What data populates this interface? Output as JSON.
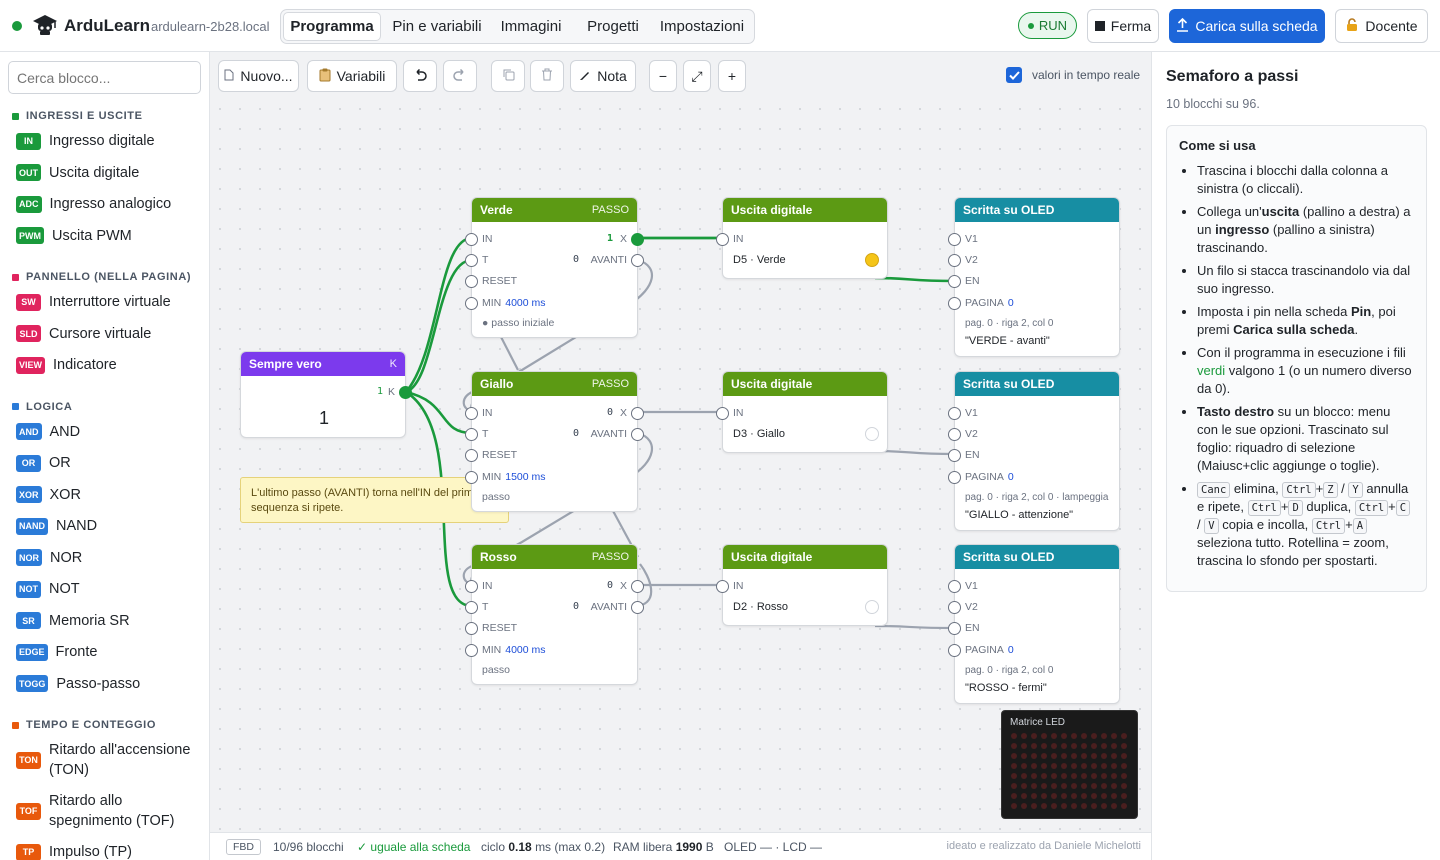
{
  "app": {
    "name": "ArduLearn",
    "host": "ardulearn-2b28.local"
  },
  "tabs": [
    {
      "label": "Programma",
      "active": true
    },
    {
      "label": "Pin e variabili"
    },
    {
      "label": "Immagini"
    },
    {
      "label": "Progetti"
    },
    {
      "label": "Impostazioni"
    }
  ],
  "header": {
    "run_label": "RUN",
    "stop_label": "Ferma",
    "upload_label": "Carica sulla scheda",
    "teacher_label": "Docente"
  },
  "palette": {
    "search_placeholder": "Cerca blocco...",
    "categories": [
      {
        "title": "INGRESSI E USCITE",
        "color": "#1a9a3c",
        "items": [
          {
            "badge": "IN",
            "label": "Ingresso digitale",
            "color": "#1a9a3c"
          },
          {
            "badge": "OUT",
            "label": "Uscita digitale",
            "color": "#1a9a3c"
          },
          {
            "badge": "ADC",
            "label": "Ingresso analogico",
            "color": "#1a9a3c"
          },
          {
            "badge": "PWM",
            "label": "Uscita PWM",
            "color": "#1a9a3c"
          }
        ]
      },
      {
        "title": "PANNELLO (NELLA PAGINA)",
        "color": "#e0245e",
        "items": [
          {
            "badge": "SW",
            "label": "Interruttore virtuale",
            "color": "#e0245e"
          },
          {
            "badge": "SLD",
            "label": "Cursore virtuale",
            "color": "#e0245e"
          },
          {
            "badge": "VIEW",
            "label": "Indicatore",
            "color": "#e0245e"
          }
        ]
      },
      {
        "title": "LOGICA",
        "color": "#2b7bd8",
        "items": [
          {
            "badge": "AND",
            "label": "AND",
            "color": "#2b7bd8"
          },
          {
            "badge": "OR",
            "label": "OR",
            "color": "#2b7bd8"
          },
          {
            "badge": "XOR",
            "label": "XOR",
            "color": "#2b7bd8"
          },
          {
            "badge": "NAND",
            "label": "NAND",
            "color": "#2b7bd8"
          },
          {
            "badge": "NOR",
            "label": "NOR",
            "color": "#2b7bd8"
          },
          {
            "badge": "NOT",
            "label": "NOT",
            "color": "#2b7bd8"
          },
          {
            "badge": "SR",
            "label": "Memoria SR",
            "color": "#2b7bd8"
          },
          {
            "badge": "EDGE",
            "label": "Fronte",
            "color": "#2b7bd8"
          },
          {
            "badge": "TOGG",
            "label": "Passo-passo",
            "color": "#2b7bd8"
          }
        ]
      },
      {
        "title": "TEMPO E CONTEGGIO",
        "color": "#e8590c",
        "items": [
          {
            "badge": "TON",
            "label": "Ritardo all'accensione (TON)",
            "color": "#e8590c"
          },
          {
            "badge": "TOF",
            "label": "Ritardo allo spegnimento (TOF)",
            "color": "#e8590c"
          },
          {
            "badge": "TP",
            "label": "Impulso (TP)",
            "color": "#e8590c"
          }
        ]
      }
    ]
  },
  "toolbar": {
    "new_label": "Nuovo...",
    "vars_label": "Variabili",
    "note_label": "Nota",
    "live_label": "valori in tempo reale",
    "live_checked": true
  },
  "canvas": {
    "const_node": {
      "title": "Sempre vero",
      "tag": "K",
      "out_label": "K",
      "out_value": "1",
      "value": "1"
    },
    "note": {
      "text": "L'ultimo passo (AVANTI) torna nell'IN del primo: la sequenza si ripete."
    },
    "steps": [
      {
        "title": "Verde",
        "tag": "PASSO",
        "color": "#5c9a14",
        "x_value": "1",
        "x_on": true,
        "avanti_value": "0",
        "min_value": "4000 ms",
        "footer": "● passo iniziale"
      },
      {
        "title": "Giallo",
        "tag": "PASSO",
        "color": "#5c9a14",
        "x_value": "0",
        "x_on": false,
        "avanti_value": "0",
        "min_value": "1500 ms",
        "footer": "passo"
      },
      {
        "title": "Rosso",
        "tag": "PASSO",
        "color": "#5c9a14",
        "x_value": "0",
        "x_on": false,
        "avanti_value": "0",
        "min_value": "4000 ms",
        "footer": "passo"
      }
    ],
    "outputs": [
      {
        "title": "Uscita digitale",
        "pin": "D5 · Verde",
        "led_on": true
      },
      {
        "title": "Uscita digitale",
        "pin": "D3 · Giallo",
        "led_on": false
      },
      {
        "title": "Uscita digitale",
        "pin": "D2 · Rosso",
        "led_on": false
      }
    ],
    "oleds": [
      {
        "title": "Scritta su OLED",
        "page_value": "0",
        "info": "pag. 0 · riga 2, col 0",
        "text": "\"VERDE - avanti\""
      },
      {
        "title": "Scritta su OLED",
        "page_value": "0",
        "info": "pag. 0 · riga 2, col 0 · lampeggia",
        "text": "\"GIALLO - attenzione\""
      },
      {
        "title": "Scritta su OLED",
        "page_value": "0",
        "info": "pag. 0 · riga 2, col 0",
        "text": "\"ROSSO - fermi\""
      }
    ],
    "port_labels": {
      "in": "IN",
      "t": "T",
      "reset": "RESET",
      "min": "MIN",
      "x": "X",
      "avanti": "AVANTI",
      "v1": "V1",
      "v2": "V2",
      "en": "EN",
      "pagina": "PAGINA"
    },
    "matrix_label": "Matrice LED"
  },
  "status": {
    "mode": "FBD",
    "blocks": "10/96 blocchi",
    "sync": "✓ uguale alla scheda",
    "cycle_prefix": "ciclo",
    "cycle_value": "0.18",
    "cycle_suffix": "ms (max 0.2)",
    "ram_prefix": "RAM libera",
    "ram_value": "1990",
    "ram_suffix": "B",
    "displays": "OLED — · LCD —",
    "credit": "ideato e realizzato da Daniele Michelotti"
  },
  "side": {
    "title": "Semaforo a passi",
    "subtitle": "10 blocchi su 96.",
    "howto_title": "Come si usa"
  },
  "howto": {
    "b1": "Trascina i blocchi dalla colonna a sinistra (o cliccali).",
    "b2a": "Collega un'",
    "b2b": "uscita",
    "b2c": " (pallino a destra) a un ",
    "b2d": "ingresso",
    "b2e": " (pallino a sinistra) trascinando.",
    "b3": "Un filo si stacca trascinandolo via dal suo ingresso.",
    "b4a": "Imposta i pin nella scheda ",
    "b4b": "Pin",
    "b4c": ", poi premi ",
    "b4d": "Carica sulla scheda",
    "b4e": ".",
    "b5a": "Con il programma in esecuzione i fili ",
    "b5b": "verdi",
    "b5c": " valgono 1 (o un numero diverso da 0).",
    "b6a": "Tasto destro",
    "b6b": " su un blocco: menu con le sue opzioni. Trascinato sul foglio: riquadro di selezione (Maiusc+clic aggiunge o toglie).",
    "b7_canc": "Canc",
    "b7a": " elimina, ",
    "b7_ctrl": "Ctrl",
    "b7_z": "Z",
    "b7_y": "Y",
    "b7b": " annulla e ripete, ",
    "b7_d": "D",
    "b7c": " duplica, ",
    "b7_c": "C",
    "b7_v": "V",
    "b7d": " copia e incolla, ",
    "b7_a": "A",
    "b7e": " seleziona tutto. Rotellina = zoom, trascina lo sfondo per spostarti.",
    "plus": "+",
    "slash": "/"
  },
  "colors": {
    "green": "#1a9a3c",
    "step": "#5c9a14",
    "output": "#5c9a14",
    "oled": "#178ea3",
    "const": "#7c3aed",
    "accent": "#1d66d9"
  }
}
